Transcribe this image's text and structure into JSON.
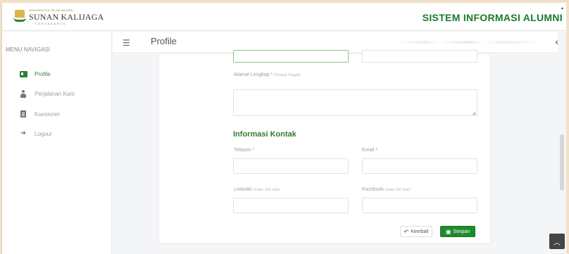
{
  "header": {
    "logo_small": "UNIVERSITAS ISLAM NEGERI",
    "logo_main": "SUNAN KALIJAGA",
    "logo_sub": "YOGYAKARTA",
    "app_title": "SISTEM INFORMASI ALUMNI"
  },
  "sidebar": {
    "menu_header": "MENU NAVIGASI",
    "items": [
      {
        "label": "Profile",
        "icon": "id-card-icon",
        "active": true
      },
      {
        "label": "Perjalanan Karir",
        "icon": "user-icon",
        "active": false
      },
      {
        "label": "Kuesioner",
        "icon": "document-icon",
        "active": false
      },
      {
        "label": "Logout",
        "icon": "logout-icon",
        "active": false
      }
    ]
  },
  "topbar": {
    "page_title": "Profile",
    "collapse_icon": "chevron-left-icon",
    "menu_icon": "hamburger-icon"
  },
  "form": {
    "address_label": "Alamat Lengkap *",
    "address_hint": "(Tempat Tinggal)",
    "address_value": "",
    "contact_section": "Informasi Kontak",
    "phone_label": "Telepon *",
    "phone_value": "",
    "email_label": "Email *",
    "email_value": "",
    "linkedin_label": "Linkedin",
    "linkedin_hint": "(maks. 250 char)",
    "linkedin_value": "",
    "facebook_label": "Facebook",
    "facebook_hint": "(maks 250 char)",
    "facebook_value": ""
  },
  "actions": {
    "back_label": "Kembali",
    "save_label": "Simpan"
  },
  "colors": {
    "brand_green": "#1b7a2e",
    "save_button": "#1e8a2e",
    "accent_gold": "#d9b64c"
  }
}
